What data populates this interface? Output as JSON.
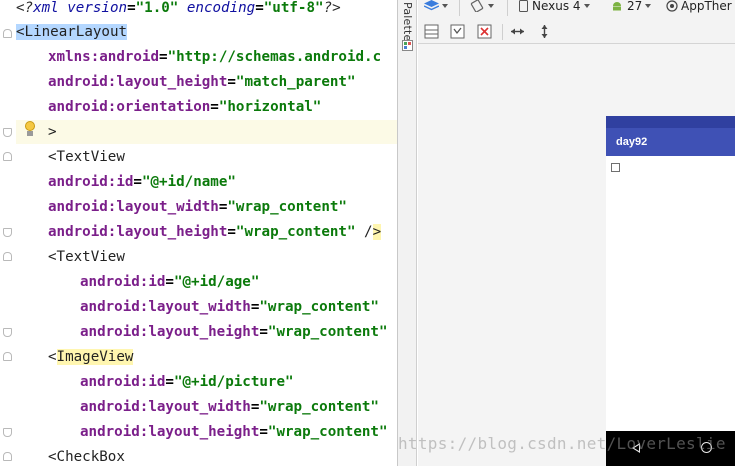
{
  "editor": {
    "lines": [
      {
        "parts": [
          {
            "c": "t-pi-bracket",
            "t": "<?"
          },
          {
            "c": "t-pi",
            "t": "xml version"
          },
          {
            "c": "t-eq",
            "t": "="
          },
          {
            "c": "t-str",
            "t": "\"1.0\""
          },
          {
            "c": "t-pi",
            "t": " encoding"
          },
          {
            "c": "t-eq",
            "t": "="
          },
          {
            "c": "t-str",
            "t": "\"utf-8\""
          },
          {
            "c": "t-pi-bracket",
            "t": "?>"
          }
        ]
      },
      {
        "parts": [
          {
            "c": "t-br tag-hl",
            "t": "<LinearLayout"
          }
        ]
      },
      {
        "parts": [
          {
            "c": "t-attr",
            "t": "xmlns:android"
          },
          {
            "c": "t-eq",
            "t": "="
          },
          {
            "c": "t-str",
            "t": "\"http://schemas.android.c"
          }
        ]
      },
      {
        "parts": [
          {
            "c": "t-attr",
            "t": "android:layout_height"
          },
          {
            "c": "t-eq",
            "t": "="
          },
          {
            "c": "t-str",
            "t": "\"match_parent\""
          }
        ]
      },
      {
        "parts": [
          {
            "c": "t-attr",
            "t": "android:orientation"
          },
          {
            "c": "t-eq",
            "t": "="
          },
          {
            "c": "t-str",
            "t": "\"horizontal\""
          }
        ]
      },
      {
        "parts": [
          {
            "c": "t-br",
            "t": ">"
          }
        ]
      },
      {
        "parts": [
          {
            "c": "t-br",
            "t": "<TextView"
          }
        ]
      },
      {
        "parts": [
          {
            "c": "t-attr",
            "t": "android:id"
          },
          {
            "c": "t-eq",
            "t": "="
          },
          {
            "c": "t-str",
            "t": "\"@+id/name\""
          }
        ]
      },
      {
        "parts": [
          {
            "c": "t-attr",
            "t": "android:layout_width"
          },
          {
            "c": "t-eq",
            "t": "="
          },
          {
            "c": "t-str",
            "t": "\"wrap_content\""
          }
        ]
      },
      {
        "parts": [
          {
            "c": "t-attr",
            "t": "android:layout_height"
          },
          {
            "c": "t-eq",
            "t": "="
          },
          {
            "c": "t-str",
            "t": "\"wrap_content\""
          },
          {
            "c": "t-br",
            "t": " /"
          },
          {
            "c": "t-br tag-hl2",
            "t": ">"
          }
        ]
      },
      {
        "parts": [
          {
            "c": "t-br",
            "t": "<TextView"
          }
        ]
      },
      {
        "parts": [
          {
            "c": "t-attr",
            "t": "android:id"
          },
          {
            "c": "t-eq",
            "t": "="
          },
          {
            "c": "t-str",
            "t": "\"@+id/age\""
          }
        ]
      },
      {
        "parts": [
          {
            "c": "t-attr",
            "t": "android:layout_width"
          },
          {
            "c": "t-eq",
            "t": "="
          },
          {
            "c": "t-str",
            "t": "\"wrap_content\""
          }
        ]
      },
      {
        "parts": [
          {
            "c": "t-attr",
            "t": "android:layout_height"
          },
          {
            "c": "t-eq",
            "t": "="
          },
          {
            "c": "t-str",
            "t": "\"wrap_content\""
          }
        ]
      },
      {
        "parts": [
          {
            "c": "t-br",
            "t": "<"
          },
          {
            "c": "t-br tag-hl2",
            "t": "ImageView"
          }
        ]
      },
      {
        "parts": [
          {
            "c": "t-attr",
            "t": "android:id"
          },
          {
            "c": "t-eq",
            "t": "="
          },
          {
            "c": "t-str",
            "t": "\"@+id/picture\""
          }
        ]
      },
      {
        "parts": [
          {
            "c": "t-attr",
            "t": "android:layout_width"
          },
          {
            "c": "t-eq",
            "t": "="
          },
          {
            "c": "t-str",
            "t": "\"wrap_content\""
          }
        ]
      },
      {
        "parts": [
          {
            "c": "t-attr",
            "t": "android:layout_height"
          },
          {
            "c": "t-eq",
            "t": "="
          },
          {
            "c": "t-str",
            "t": "\"wrap_content\""
          }
        ]
      },
      {
        "parts": [
          {
            "c": "t-br",
            "t": "<CheckBox"
          }
        ]
      }
    ]
  },
  "palette": {
    "label": "Palette"
  },
  "toolbar": {
    "design_surface_icon": "layers-icon",
    "orientation_icon": "rotate-icon",
    "device_label": "Nexus 4",
    "api_label": "27",
    "theme_label": "AppTher"
  },
  "toolbar2": {
    "icons": [
      "grid-icon",
      "select-icon",
      "clear-icon",
      "horizontal-arrows-icon",
      "vertical-arrows-icon"
    ]
  },
  "preview": {
    "app_title": "day92",
    "accent": "#3f51b5",
    "status_color": "#3040a0"
  },
  "watermark": {
    "text": "https://blog.csdn.net/LoverLeslie"
  }
}
